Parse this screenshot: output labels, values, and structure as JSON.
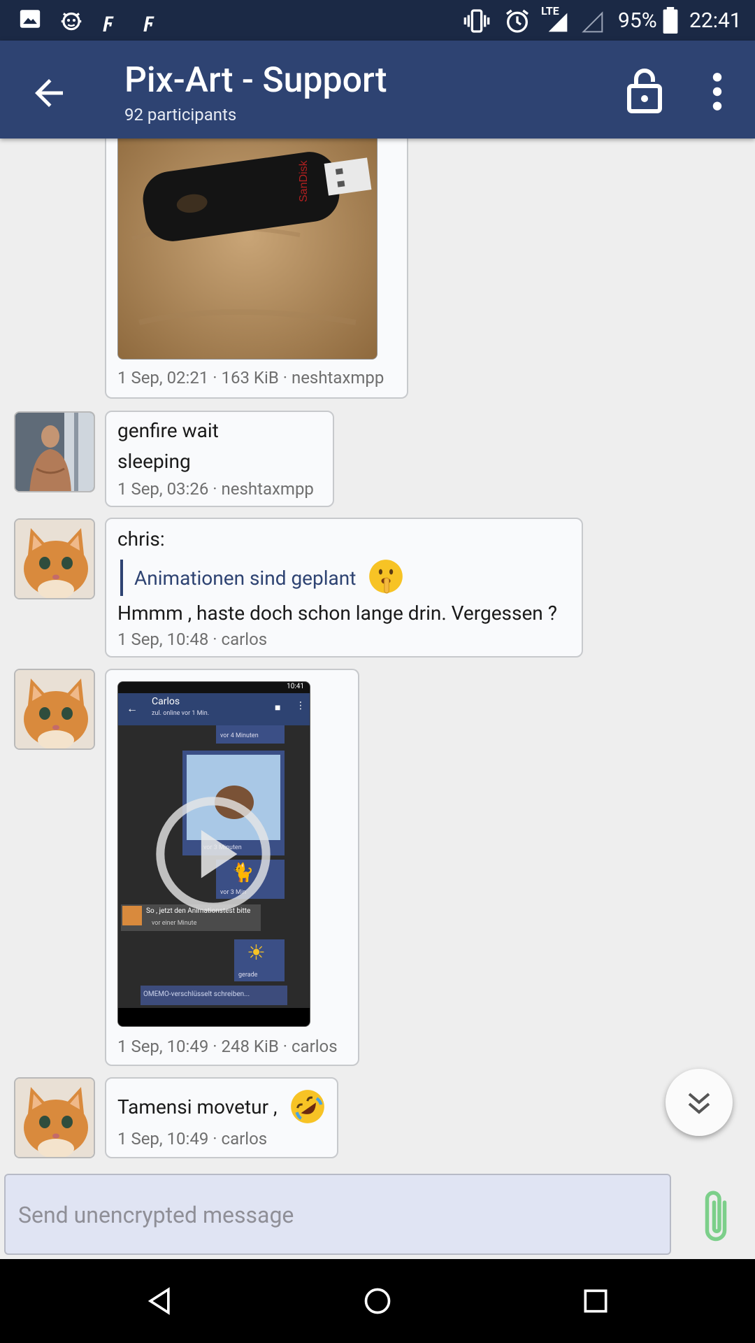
{
  "status_bar": {
    "battery_percent": "95%",
    "time": "22:41",
    "network": "LTE",
    "icons": [
      "image-icon",
      "bug-icon",
      "f-app-icon",
      "f-app-icon",
      "vibrate-icon",
      "alarm-icon",
      "signal-icon",
      "signal-empty-icon",
      "battery-icon"
    ]
  },
  "toolbar": {
    "title": "Pix-Art - Support",
    "subtitle": "92 participants",
    "back_icon": "arrow-back-icon",
    "lock_icon": "lock-open-icon",
    "menu_icon": "more-vert-icon"
  },
  "messages": [
    {
      "type": "image",
      "description_icon": "usb-stick-photo",
      "meta": "1 Sep, 02:21 · 163 KiB · neshtaxmpp"
    },
    {
      "type": "text",
      "lines": [
        "genfire wait",
        "sleeping"
      ],
      "meta": "1 Sep, 03:26 · neshtaxmpp"
    },
    {
      "type": "quote",
      "sender_line": "chris:",
      "quote": "Animationen sind geplant",
      "text": "Hmmm , haste doch schon lange drin. Vergessen ?",
      "meta": "1 Sep, 10:48 · carlos"
    },
    {
      "type": "video",
      "meta": "1 Sep, 10:49 · 248 KiB · carlos",
      "preview": {
        "time": "10:41",
        "title": "Carlos",
        "subtitle": "zul. online vor 1 Min.",
        "msg1": "vor 4 Minuten",
        "msg2": "vor 3 Minuten",
        "msg3": "vor 3 Min",
        "msg4": "So , jetzt den Animationstest bitte",
        "msg4_meta": "vor einer Minute",
        "msg5": "gerade",
        "input": "OMEMO-verschlüsselt schreiben..."
      }
    },
    {
      "type": "text",
      "lines": [
        "Tamensi movetur ,"
      ],
      "meta": "1 Sep, 10:49 · carlos"
    }
  ],
  "input": {
    "placeholder": "Send unencrypted message"
  },
  "colors": {
    "toolbar": "#2e4372",
    "statusbar": "#1b2945",
    "accent": "#2e4372",
    "attach": "#7ccf8a"
  }
}
